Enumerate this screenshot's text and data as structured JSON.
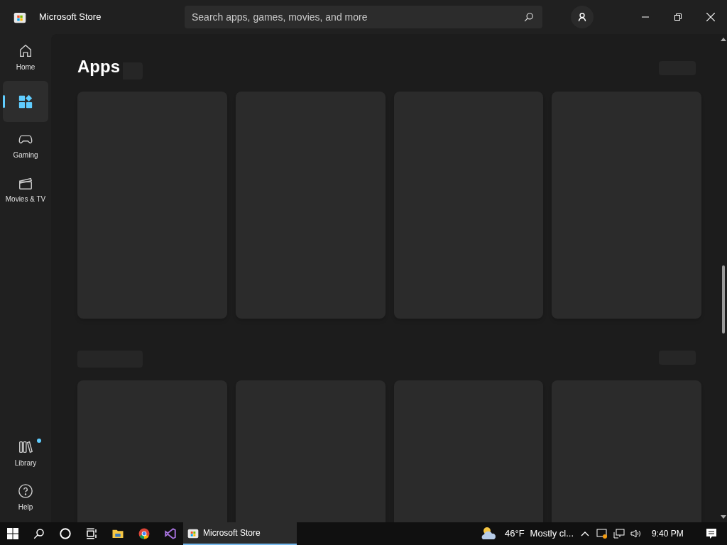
{
  "window": {
    "title": "Microsoft Store"
  },
  "search": {
    "placeholder": "Search apps, games, movies, and more"
  },
  "nav": [
    {
      "kind": "home",
      "label": "Home",
      "selected": false
    },
    {
      "kind": "apps",
      "selected": true
    },
    {
      "kind": "gaming",
      "label": "Gaming",
      "selected": false
    },
    {
      "kind": "movies",
      "label": "Movies & TV",
      "selected": false
    }
  ],
  "nav_bottom": [
    {
      "kind": "library",
      "label": "Library",
      "badge": true
    },
    {
      "kind": "help",
      "label": "Help",
      "badge": false
    }
  ],
  "page": {
    "title": "Apps"
  },
  "taskbar": {
    "pinned": [
      {
        "kind": "search"
      },
      {
        "kind": "cortana"
      },
      {
        "kind": "taskview"
      },
      {
        "kind": "explorer"
      },
      {
        "kind": "chrome"
      },
      {
        "kind": "vs"
      }
    ],
    "active_app": {
      "label": "Microsoft Store"
    },
    "weather": {
      "temp": "46°F",
      "text": "Mostly cl..."
    },
    "clock": "9:40 PM"
  }
}
